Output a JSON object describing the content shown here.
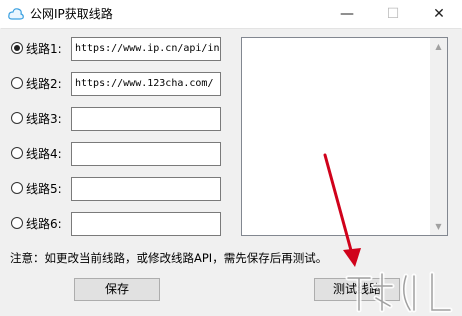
{
  "window": {
    "title": "公网IP获取线路",
    "min_glyph": "—",
    "max_glyph": "☐",
    "close_glyph": "✕"
  },
  "routes": [
    {
      "label": "线路1:",
      "value": "https://www.ip.cn/api/index",
      "selected": true
    },
    {
      "label": "线路2:",
      "value": "https://www.123cha.com/",
      "selected": false
    },
    {
      "label": "线路3:",
      "value": "",
      "selected": false
    },
    {
      "label": "线路4:",
      "value": "",
      "selected": false
    },
    {
      "label": "线路5:",
      "value": "",
      "selected": false
    },
    {
      "label": "线路6:",
      "value": "",
      "selected": false
    }
  ],
  "scrollbar": {
    "up_glyph": "▲",
    "down_glyph": "▼"
  },
  "note": "注意：如更改当前线路，或修改线路API，需先保存后再测试。",
  "buttons": {
    "save": "保存",
    "test": "测试线路"
  },
  "colors": {
    "annotation_arrow": "#d0021b"
  }
}
